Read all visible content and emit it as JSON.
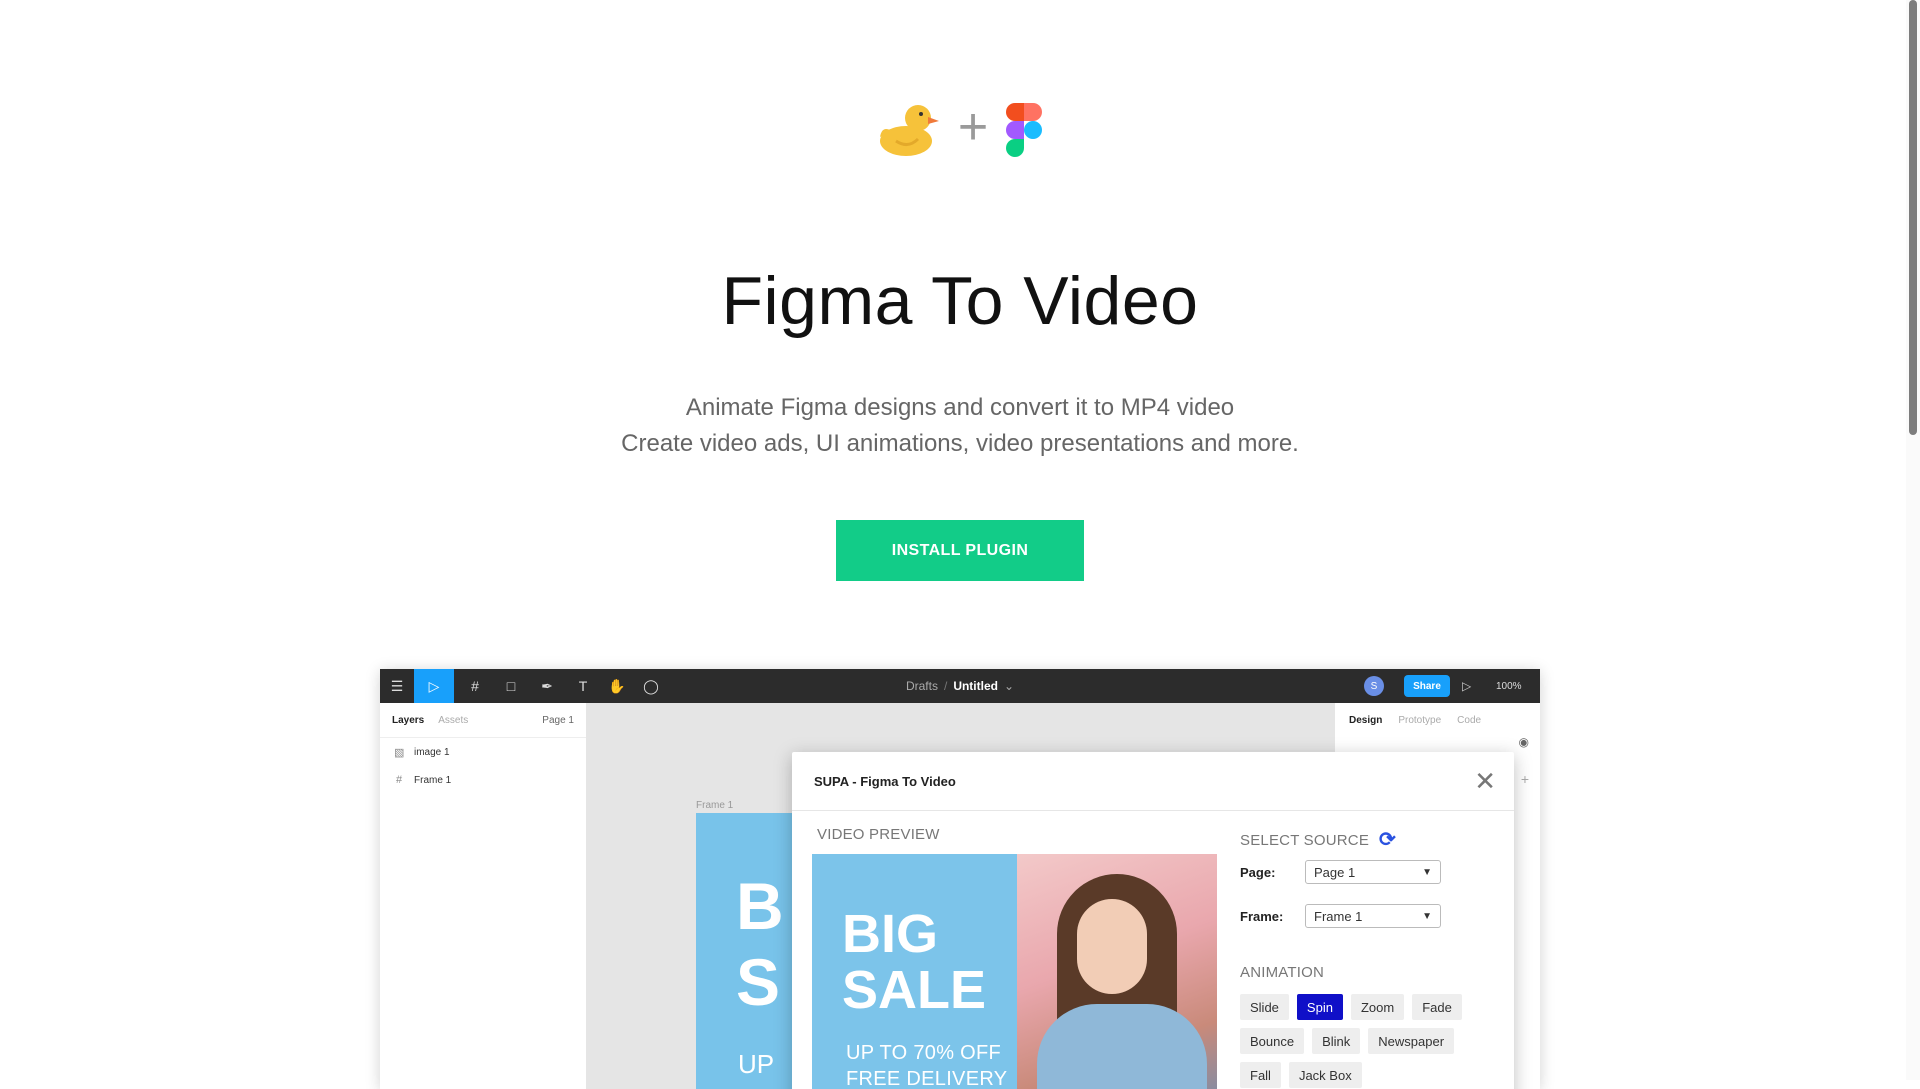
{
  "hero": {
    "logo_left": "duck",
    "logo_plus": "+",
    "logo_right": "figma",
    "title": "Figma To Video",
    "subtitle_line1": "Animate Figma designs and convert it to MP4 video",
    "subtitle_line2": "Create video ads, UI animations, video presentations and more.",
    "install_label": "INSTALL PLUGIN",
    "accent": "#12cc88"
  },
  "figma": {
    "toolbar": {
      "menu_icon": "☰",
      "move_icon": "▷",
      "frame_icon": "#",
      "shape_icon": "□",
      "pen_icon": "✒",
      "text_icon": "T",
      "hand_icon": "✋",
      "comment_icon": "◯",
      "breadcrumb_root": "Drafts",
      "breadcrumb_sep": "/",
      "file_name": "Untitled",
      "file_chevron": "⌄",
      "avatar_initial": "S",
      "share_label": "Share",
      "play_icon": "▷",
      "zoom": "100%"
    },
    "left_panel": {
      "tab_layers": "Layers",
      "tab_assets": "Assets",
      "page": "Page 1",
      "layers": [
        {
          "icon": "▧",
          "label": "image 1"
        },
        {
          "icon": "#",
          "label": "Frame 1"
        }
      ]
    },
    "canvas": {
      "frame_label": "Frame 1",
      "art_line1": "B",
      "art_line2": "S",
      "art_line3": "UP"
    },
    "right_panel": {
      "tab_design": "Design",
      "tab_prototype": "Prototype",
      "tab_code": "Code",
      "eye_icon": "◉",
      "plus_icon": "+"
    },
    "plugin": {
      "title": "SUPA - Figma To Video",
      "close_icon": "✕",
      "video_preview_label": "VIDEO PREVIEW",
      "preview_big": "BIG",
      "preview_sale": "SALE",
      "preview_line1": "UP TO 70% OFF",
      "preview_line2": "FREE DELIVERY",
      "select_source_label": "SELECT SOURCE",
      "refresh_icon": "⟳",
      "page_label": "Page:",
      "page_value": "Page 1",
      "frame_label": "Frame:",
      "frame_value": "Frame 1",
      "animation_label": "ANIMATION",
      "animations": [
        "Slide",
        "Spin",
        "Zoom",
        "Fade",
        "Bounce",
        "Blink",
        "Newspaper",
        "Fall",
        "Jack Box"
      ],
      "selected_animation": "Spin",
      "selected_color": "#1010c8"
    }
  }
}
